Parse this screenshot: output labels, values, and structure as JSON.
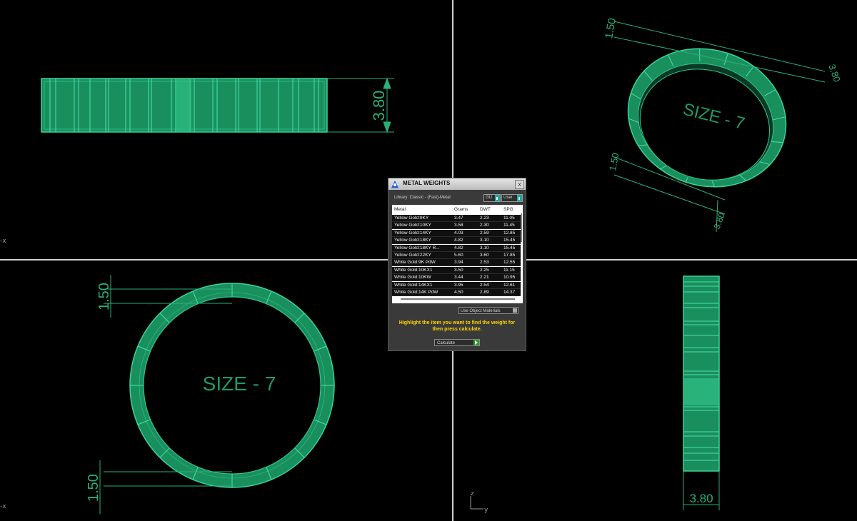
{
  "viewports": {
    "top_left": {
      "dimension": "3.80"
    },
    "top_right": {
      "size_label": "SIZE - 7",
      "dim_a": "1.50",
      "dim_b": "3.80",
      "dim_c": "1.50",
      "dim_d": "3.80"
    },
    "bottom_left": {
      "size_label": "SIZE - 7",
      "dim_top": "1.50",
      "dim_bottom": "1.50"
    },
    "bottom_right": {
      "dimension": "3.80",
      "axis_z": "z",
      "axis_y": "y"
    }
  },
  "left_axis_marks": [
    "-x",
    "-x"
  ],
  "dialog": {
    "title": "METAL WEIGHTS",
    "close_label": "x",
    "library_label": "Library: Classic - (Fast)-Metal",
    "unit_select": "GU",
    "scope_select": "User",
    "columns": [
      "Metal",
      "Grams",
      "DWT",
      "SPG"
    ],
    "rows": [
      {
        "metal": "Yellow Gold:9KY",
        "grams": "3.47",
        "dwt": "2.23",
        "spg": "11.05"
      },
      {
        "metal": "Yellow Gold:10KY",
        "grams": "3.58",
        "dwt": "2.30",
        "spg": "11.45"
      },
      {
        "metal": "Yellow Gold:14KY",
        "grams": "4.03",
        "dwt": "2.59",
        "spg": "12.85"
      },
      {
        "metal": "Yellow Gold:18KY",
        "grams": "4.82",
        "dwt": "3.10",
        "spg": "15.45"
      },
      {
        "metal": "Yellow Gold:18KY R...",
        "grams": "4.82",
        "dwt": "3.10",
        "spg": "15.45"
      },
      {
        "metal": "Yellow Gold:22KY",
        "grams": "5.60",
        "dwt": "3.60",
        "spg": "17.85"
      },
      {
        "metal": "White Gold:9K PdW",
        "grams": "3.94",
        "dwt": "2.53",
        "spg": "12.55"
      },
      {
        "metal": "White Gold:10KX1",
        "grams": "3.50",
        "dwt": "2.25",
        "spg": "11.15"
      },
      {
        "metal": "White Gold:10KW",
        "grams": "3.44",
        "dwt": "2.21",
        "spg": "10.95"
      },
      {
        "metal": "White Gold:14KX1",
        "grams": "3.95",
        "dwt": "2.54",
        "spg": "12.61"
      },
      {
        "metal": "White Gold:14K PdW",
        "grams": "4.50",
        "dwt": "2.89",
        "spg": "14.37"
      }
    ],
    "use_object_materials": "Use Object Materials",
    "hint": "Highlight the item you want to find the weight for then press calculate.",
    "calculate_label": "Calculate"
  },
  "colors": {
    "ring_fill": "#1f9a66",
    "ring_line": "#38d39a",
    "dimension": "#29b07a",
    "background": "#000000",
    "hint_text": "#ffd400"
  }
}
